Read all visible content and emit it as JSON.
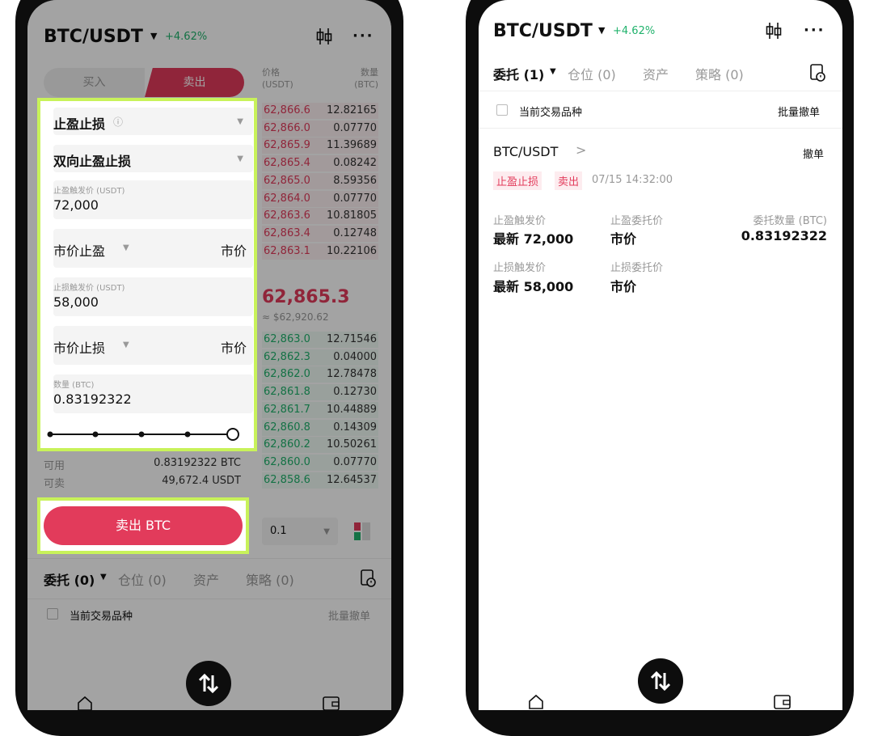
{
  "left": {
    "header": {
      "pair": "BTC/USDT",
      "change": "+4.62%"
    },
    "side_tabs": {
      "buy": "买入",
      "sell": "卖出"
    },
    "form": {
      "order_type": "止盈止损",
      "mode": "双向止盈止损",
      "tp_trigger_label": "止盈触发价 (USDT)",
      "tp_trigger_value": "72,000",
      "tp_order_type": "市价止盈",
      "tp_price": "市价",
      "sl_trigger_label": "止损触发价 (USDT)",
      "sl_trigger_value": "58,000",
      "sl_order_type": "市价止损",
      "sl_price": "市价",
      "qty_label": "数量 (BTC)",
      "qty_value": "0.83192322",
      "slider_level": 1.0
    },
    "balances": {
      "available_label": "可用",
      "available_value": "0.83192322 BTC",
      "sellable_label": "可卖",
      "sellable_value": "49,672.4 USDT"
    },
    "submit_label": "卖出 BTC",
    "orderbook": {
      "price_header": "价格\n(USDT)",
      "qty_header": "数量\n(BTC)",
      "asks": [
        {
          "price": "62,866.6",
          "qty": "12.82165"
        },
        {
          "price": "62,866.0",
          "qty": "0.07770"
        },
        {
          "price": "62,865.9",
          "qty": "11.39689"
        },
        {
          "price": "62,865.4",
          "qty": "0.08242"
        },
        {
          "price": "62,865.0",
          "qty": "8.59356"
        },
        {
          "price": "62,864.0",
          "qty": "0.07770"
        },
        {
          "price": "62,863.6",
          "qty": "10.81805"
        },
        {
          "price": "62,863.4",
          "qty": "0.12748"
        },
        {
          "price": "62,863.1",
          "qty": "10.22106"
        }
      ],
      "last_price": "62,865.3",
      "last_price_usd": "≈ $62,920.62",
      "bids": [
        {
          "price": "62,863.0",
          "qty": "12.71546"
        },
        {
          "price": "62,862.3",
          "qty": "0.04000"
        },
        {
          "price": "62,862.0",
          "qty": "12.78478"
        },
        {
          "price": "62,861.8",
          "qty": "0.12730"
        },
        {
          "price": "62,861.7",
          "qty": "10.44889"
        },
        {
          "price": "62,860.8",
          "qty": "0.14309"
        },
        {
          "price": "62,860.2",
          "qty": "10.50261"
        },
        {
          "price": "62,860.0",
          "qty": "0.07770"
        },
        {
          "price": "62,858.6",
          "qty": "12.64537"
        }
      ],
      "precision": "0.1"
    },
    "tabs": {
      "orders": "委托 (0)",
      "positions": "仓位 (0)",
      "assets": "资产",
      "strategy": "策略 (0)"
    },
    "filter": {
      "current_symbol": "当前交易品种",
      "cancel_all": "批量撤单"
    }
  },
  "right": {
    "header": {
      "pair": "BTC/USDT",
      "change": "+4.62%"
    },
    "tabs": {
      "orders": "委托 (1)",
      "positions": "仓位 (0)",
      "assets": "资产",
      "strategy": "策略 (0)"
    },
    "filter": {
      "current_symbol": "当前交易品种",
      "cancel_all": "批量撤单"
    },
    "order": {
      "symbol": "BTC/USDT",
      "cancel": "撤单",
      "tag_type": "止盈止损",
      "tag_side": "卖出",
      "time": "07/15 14:32:00",
      "tp_trigger_label": "止盈触发价",
      "tp_trigger_value": "最新 72,000",
      "tp_order_label": "止盈委托价",
      "tp_order_value": "市价",
      "qty_label": "委托数量 (BTC)",
      "qty_value": "0.83192322",
      "sl_trigger_label": "止损触发价",
      "sl_trigger_value": "最新 58,000",
      "sl_order_label": "止损委托价",
      "sl_order_value": "市价"
    }
  },
  "colors": {
    "sell": "#e23b5b",
    "buy": "#20b26c",
    "highlight": "#c8f25a"
  }
}
